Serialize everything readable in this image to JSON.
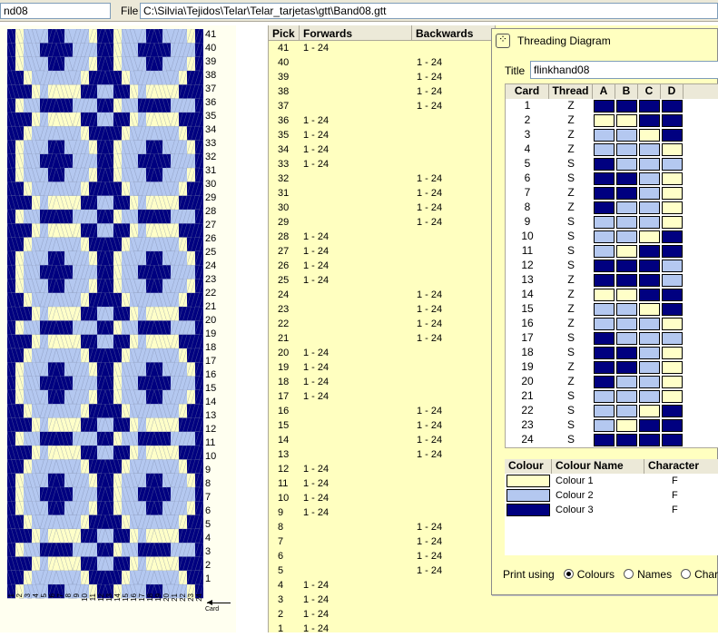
{
  "file_bar": {
    "left_value": "nd08",
    "label": "File",
    "path": "C:\\Silvia\\Tejidos\\Telar\\Telar_tarjetas\\gtt\\Band08.gtt"
  },
  "colors": {
    "c1": "#ffffc8",
    "c2": "#b4c8f0",
    "c3": "#000080"
  },
  "design": {
    "pick_labels": [
      "41",
      "40",
      "39",
      "38",
      "37",
      "36",
      "35",
      "34",
      "33",
      "32",
      "31",
      "30",
      "29",
      "28",
      "27",
      "26",
      "25",
      "24",
      "23",
      "22",
      "21",
      "20",
      "19",
      "18",
      "17",
      "16",
      "15",
      "14",
      "13",
      "12",
      "11",
      "10",
      "9",
      "8",
      "7",
      "6",
      "5",
      "4",
      "3",
      "2",
      "1"
    ],
    "card_labels": [
      "1",
      "2",
      "3",
      "4",
      "5",
      "6",
      "7",
      "8",
      "9",
      "10",
      "11",
      "12",
      "13",
      "14",
      "15",
      "16",
      "17",
      "18",
      "19",
      "20",
      "21",
      "22",
      "23",
      "24"
    ],
    "card_axis_label": "Card"
  },
  "picklist": {
    "headers": [
      "Pick",
      "Forwards",
      "Backwards"
    ],
    "rows": [
      {
        "pick": "41",
        "forwards": "1 - 24",
        "backwards": ""
      },
      {
        "pick": "40",
        "forwards": "",
        "backwards": "1 - 24"
      },
      {
        "pick": "39",
        "forwards": "",
        "backwards": "1 - 24"
      },
      {
        "pick": "38",
        "forwards": "",
        "backwards": "1 - 24"
      },
      {
        "pick": "37",
        "forwards": "",
        "backwards": "1 - 24"
      },
      {
        "pick": "36",
        "forwards": "1 - 24",
        "backwards": ""
      },
      {
        "pick": "35",
        "forwards": "1 - 24",
        "backwards": ""
      },
      {
        "pick": "34",
        "forwards": "1 - 24",
        "backwards": ""
      },
      {
        "pick": "33",
        "forwards": "1 - 24",
        "backwards": ""
      },
      {
        "pick": "32",
        "forwards": "",
        "backwards": "1 - 24"
      },
      {
        "pick": "31",
        "forwards": "",
        "backwards": "1 - 24"
      },
      {
        "pick": "30",
        "forwards": "",
        "backwards": "1 - 24"
      },
      {
        "pick": "29",
        "forwards": "",
        "backwards": "1 - 24"
      },
      {
        "pick": "28",
        "forwards": "1 - 24",
        "backwards": ""
      },
      {
        "pick": "27",
        "forwards": "1 - 24",
        "backwards": ""
      },
      {
        "pick": "26",
        "forwards": "1 - 24",
        "backwards": ""
      },
      {
        "pick": "25",
        "forwards": "1 - 24",
        "backwards": ""
      },
      {
        "pick": "24",
        "forwards": "",
        "backwards": "1 - 24"
      },
      {
        "pick": "23",
        "forwards": "",
        "backwards": "1 - 24"
      },
      {
        "pick": "22",
        "forwards": "",
        "backwards": "1 - 24"
      },
      {
        "pick": "21",
        "forwards": "",
        "backwards": "1 - 24"
      },
      {
        "pick": "20",
        "forwards": "1 - 24",
        "backwards": ""
      },
      {
        "pick": "19",
        "forwards": "1 - 24",
        "backwards": ""
      },
      {
        "pick": "18",
        "forwards": "1 - 24",
        "backwards": ""
      },
      {
        "pick": "17",
        "forwards": "1 - 24",
        "backwards": ""
      },
      {
        "pick": "16",
        "forwards": "",
        "backwards": "1 - 24"
      },
      {
        "pick": "15",
        "forwards": "",
        "backwards": "1 - 24"
      },
      {
        "pick": "14",
        "forwards": "",
        "backwards": "1 - 24"
      },
      {
        "pick": "13",
        "forwards": "",
        "backwards": "1 - 24"
      },
      {
        "pick": "12",
        "forwards": "1 - 24",
        "backwards": ""
      },
      {
        "pick": "11",
        "forwards": "1 - 24",
        "backwards": ""
      },
      {
        "pick": "10",
        "forwards": "1 - 24",
        "backwards": ""
      },
      {
        "pick": "9",
        "forwards": "1 - 24",
        "backwards": ""
      },
      {
        "pick": "8",
        "forwards": "",
        "backwards": "1 - 24"
      },
      {
        "pick": "7",
        "forwards": "",
        "backwards": "1 - 24"
      },
      {
        "pick": "6",
        "forwards": "",
        "backwards": "1 - 24"
      },
      {
        "pick": "5",
        "forwards": "",
        "backwards": "1 - 24"
      },
      {
        "pick": "4",
        "forwards": "1 - 24",
        "backwards": ""
      },
      {
        "pick": "3",
        "forwards": "1 - 24",
        "backwards": ""
      },
      {
        "pick": "2",
        "forwards": "1 - 24",
        "backwards": ""
      },
      {
        "pick": "1",
        "forwards": "1 - 24",
        "backwards": ""
      }
    ]
  },
  "dialog": {
    "title": "Threading Diagram",
    "title_label": "Title",
    "title_value": "flinkhand08",
    "grid_headers": [
      "Card",
      "Thread",
      "A",
      "B",
      "C",
      "D"
    ],
    "cards": [
      {
        "card": "1",
        "thread": "Z",
        "holes": [
          3,
          3,
          3,
          3
        ]
      },
      {
        "card": "2",
        "thread": "Z",
        "holes": [
          1,
          1,
          3,
          3
        ]
      },
      {
        "card": "3",
        "thread": "Z",
        "holes": [
          2,
          2,
          1,
          3
        ]
      },
      {
        "card": "4",
        "thread": "Z",
        "holes": [
          2,
          2,
          2,
          1
        ]
      },
      {
        "card": "5",
        "thread": "S",
        "holes": [
          3,
          2,
          2,
          2
        ]
      },
      {
        "card": "6",
        "thread": "S",
        "holes": [
          3,
          3,
          2,
          1
        ]
      },
      {
        "card": "7",
        "thread": "Z",
        "holes": [
          3,
          3,
          2,
          1
        ]
      },
      {
        "card": "8",
        "thread": "Z",
        "holes": [
          3,
          2,
          2,
          1
        ]
      },
      {
        "card": "9",
        "thread": "S",
        "holes": [
          2,
          2,
          2,
          1
        ]
      },
      {
        "card": "10",
        "thread": "S",
        "holes": [
          2,
          2,
          1,
          3
        ]
      },
      {
        "card": "11",
        "thread": "S",
        "holes": [
          2,
          1,
          3,
          3
        ]
      },
      {
        "card": "12",
        "thread": "S",
        "holes": [
          3,
          3,
          3,
          2
        ]
      },
      {
        "card": "13",
        "thread": "Z",
        "holes": [
          3,
          3,
          3,
          2
        ]
      },
      {
        "card": "14",
        "thread": "Z",
        "holes": [
          1,
          1,
          3,
          3
        ]
      },
      {
        "card": "15",
        "thread": "Z",
        "holes": [
          2,
          2,
          1,
          3
        ]
      },
      {
        "card": "16",
        "thread": "Z",
        "holes": [
          2,
          2,
          2,
          1
        ]
      },
      {
        "card": "17",
        "thread": "S",
        "holes": [
          3,
          2,
          2,
          2
        ]
      },
      {
        "card": "18",
        "thread": "S",
        "holes": [
          3,
          3,
          2,
          1
        ]
      },
      {
        "card": "19",
        "thread": "Z",
        "holes": [
          3,
          3,
          2,
          1
        ]
      },
      {
        "card": "20",
        "thread": "Z",
        "holes": [
          3,
          2,
          2,
          1
        ]
      },
      {
        "card": "21",
        "thread": "S",
        "holes": [
          2,
          2,
          2,
          1
        ]
      },
      {
        "card": "22",
        "thread": "S",
        "holes": [
          2,
          2,
          1,
          3
        ]
      },
      {
        "card": "23",
        "thread": "S",
        "holes": [
          2,
          1,
          3,
          3
        ]
      },
      {
        "card": "24",
        "thread": "S",
        "holes": [
          3,
          3,
          3,
          3
        ]
      }
    ],
    "colour_headers": [
      "Colour",
      "Colour Name",
      "Character"
    ],
    "colours": [
      {
        "name": "Colour 1",
        "character": "F",
        "color": "#ffffc8"
      },
      {
        "name": "Colour 2",
        "character": "F",
        "color": "#b4c8f0"
      },
      {
        "name": "Colour 3",
        "character": "F",
        "color": "#000080"
      }
    ],
    "print_using_label": "Print using",
    "print_options": [
      "Colours",
      "Names",
      "Chara"
    ]
  }
}
